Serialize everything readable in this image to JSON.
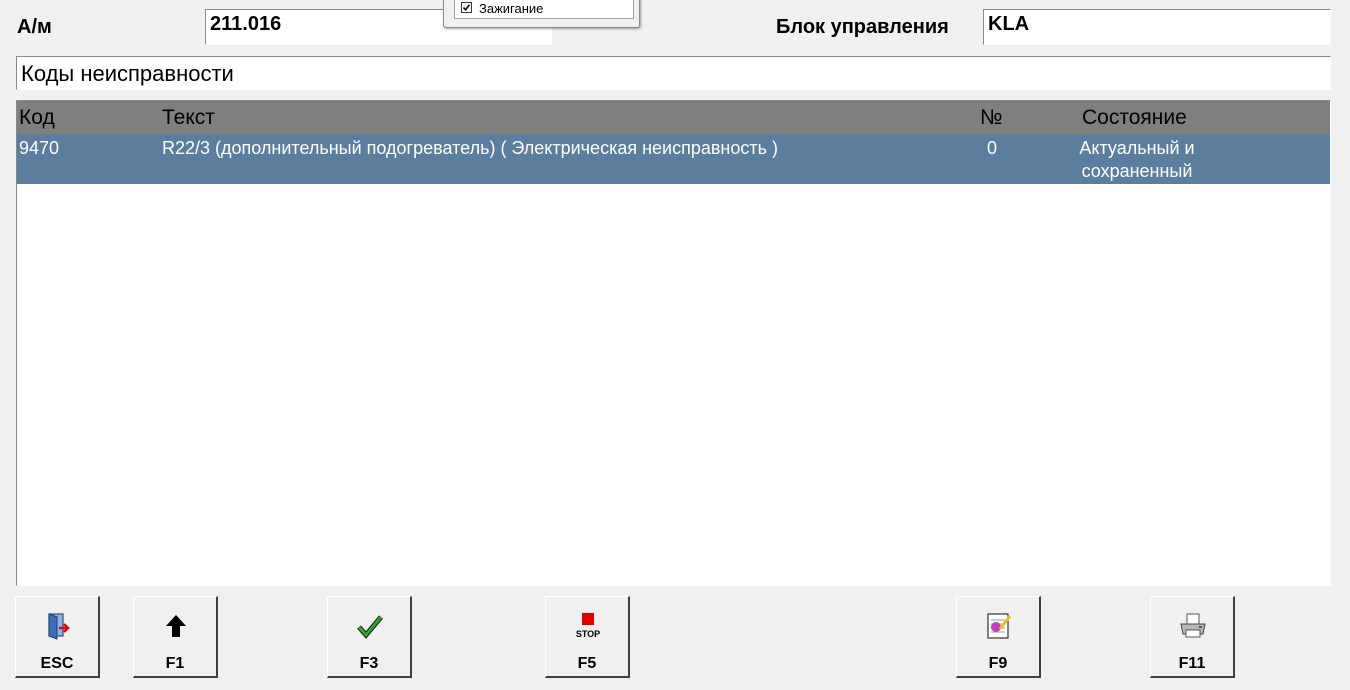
{
  "header": {
    "vehicle_label": "А/м",
    "vehicle_value": "211.016",
    "control_unit_label": "Блок управления",
    "control_unit_value": "KLA",
    "section_title": "Коды неисправности"
  },
  "popup": {
    "ignition_label": "Зажигание",
    "ignition_checked": true
  },
  "table": {
    "columns": [
      "Код",
      "Текст",
      "№",
      "Состояние"
    ],
    "rows": [
      {
        "code": "9470",
        "text": "R22/3 (дополнительный подогреватель) ( Электрическая неисправность )",
        "number": "0",
        "state_line1": "Актуальный и",
        "state_line2": "сохраненный"
      }
    ],
    "header_color": "#7f7f7f",
    "selected_row_color": "#5b7d9e"
  },
  "toolbar": [
    {
      "key": "ESC",
      "icon": "exit-door-icon"
    },
    {
      "key": "F1",
      "icon": "arrow-up-icon"
    },
    {
      "key": "F3",
      "icon": "checkmark-icon"
    },
    {
      "key": "F5",
      "icon": "stop-icon",
      "icon_text": "STOP"
    },
    {
      "key": "F9",
      "icon": "notepad-icon"
    },
    {
      "key": "F11",
      "icon": "printer-icon"
    }
  ]
}
